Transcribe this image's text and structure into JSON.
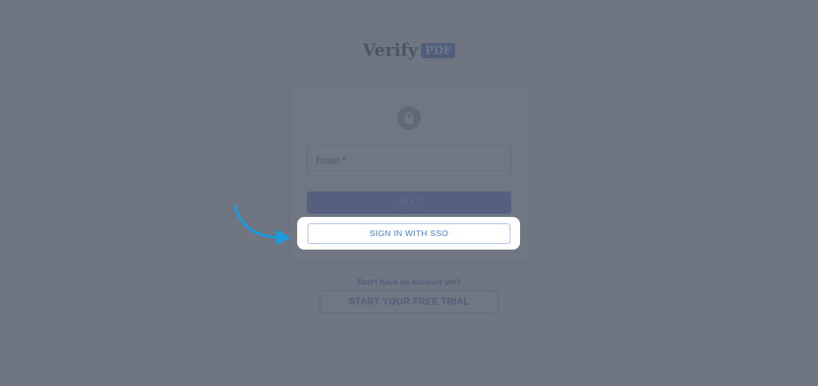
{
  "logo": {
    "word": "Verify",
    "badge": "PDF"
  },
  "card": {
    "icon": "lock-icon",
    "email_label": "Email *",
    "next_label": "NEXT",
    "sso_label": "SIGN IN WITH SSO"
  },
  "signup": {
    "prompt": "Don't have an account yet?",
    "trial_label": "START YOUR FREE TRIAL"
  },
  "annotation": {
    "arrow_icon": "arrow-right-icon",
    "highlighted_element": "sso-button"
  },
  "colors": {
    "brand_blue": "#1c5fc4",
    "primary_button": "#3c6fd8",
    "link_blue": "#2c5cc0",
    "overlay": "#585e6d",
    "arrow": "#1b9be0"
  }
}
